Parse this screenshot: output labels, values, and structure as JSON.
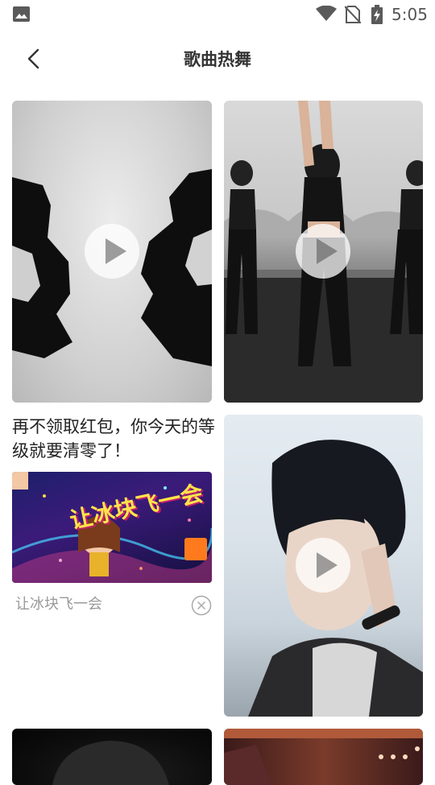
{
  "status_bar": {
    "time": "5:05",
    "icons": [
      "gallery-icon",
      "wifi-icon",
      "no-sim-icon",
      "battery-charging-icon"
    ]
  },
  "header": {
    "title": "歌曲热舞",
    "back_icon": "chevron-left-icon"
  },
  "feed": {
    "videos": [
      {
        "id": "hands-silhouette",
        "play_icon": "play-icon"
      },
      {
        "id": "dance-studio",
        "play_icon": "play-icon"
      },
      {
        "id": "portrait-boy",
        "play_icon": "play-icon"
      },
      {
        "id": "dark-portrait",
        "play_icon": "play-icon"
      },
      {
        "id": "concert-stage",
        "play_icon": "play-icon"
      }
    ],
    "ad": {
      "headline": "再不领取红包，你今天的等级就要清零了！",
      "banner_text": "让冰块飞一会",
      "source": "让冰块飞一会",
      "close_icon": "close-circle-icon"
    }
  },
  "colors": {
    "background": "#ffffff",
    "title_text": "#333333",
    "muted_text": "#999999"
  }
}
